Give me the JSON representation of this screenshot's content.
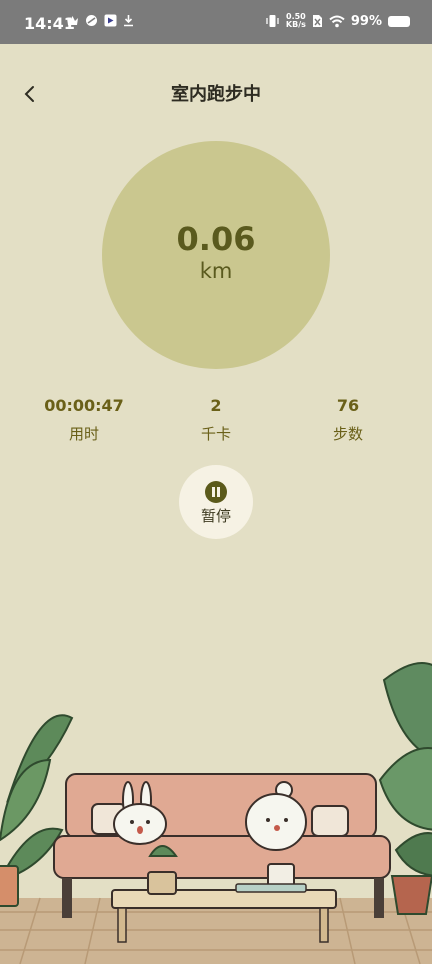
{
  "status_bar": {
    "time": "14:41",
    "net_speed_value": "0.50",
    "net_speed_unit": "KB/s",
    "battery": "99%"
  },
  "header": {
    "title": "室内跑步中"
  },
  "distance": {
    "value": "0.06",
    "unit": "km"
  },
  "stats": [
    {
      "value": "00:00:47",
      "label": "用时"
    },
    {
      "value": "2",
      "label": "千卡"
    },
    {
      "value": "76",
      "label": "步数"
    }
  ],
  "pause_button": {
    "label": "暂停"
  },
  "colors": {
    "background": "#e3dfc5",
    "circle": "#cac78f",
    "accent": "#5b5a1a",
    "status_bar": "#7b7b7b"
  }
}
